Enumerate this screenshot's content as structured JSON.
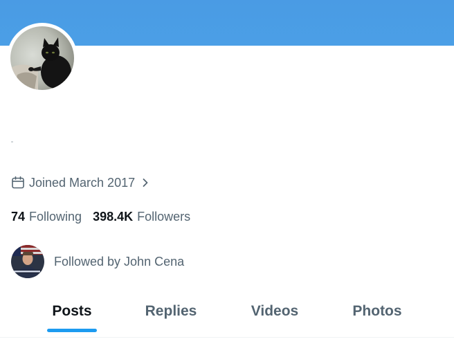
{
  "profile": {
    "joined_text": "Joined March 2017",
    "following": {
      "count": "74",
      "label": "Following"
    },
    "followers": {
      "count": "398.4K",
      "label": "Followers"
    },
    "followed_by_text": "Followed by John Cena"
  },
  "tabs": [
    {
      "label": "Posts",
      "active": true
    },
    {
      "label": "Replies",
      "active": false
    },
    {
      "label": "Videos",
      "active": false
    },
    {
      "label": "Photos",
      "active": false
    }
  ],
  "colors": {
    "banner": "#4a9be4",
    "accent": "#1d9bf0",
    "text_primary": "#0f1419",
    "text_secondary": "#536471"
  },
  "icons": {
    "joined": "calendar-icon",
    "joined_more": "chevron-right-icon"
  }
}
